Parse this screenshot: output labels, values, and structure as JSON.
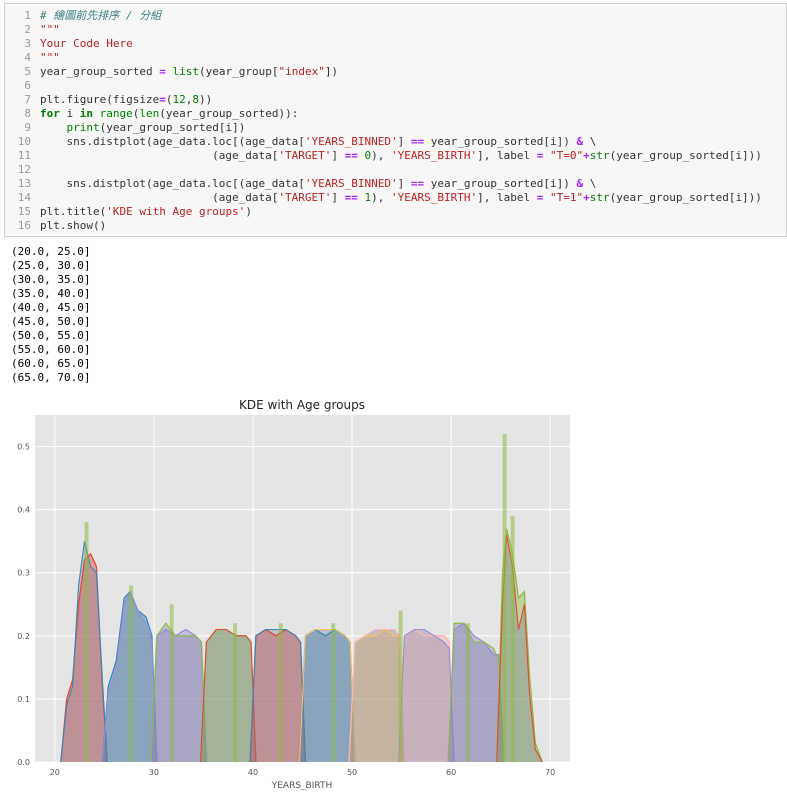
{
  "code_cell": {
    "lines": [
      {
        "n": "1",
        "parts": [
          {
            "t": "# 繪圖前先排序 / 分組",
            "c": "cm"
          }
        ]
      },
      {
        "n": "2",
        "parts": [
          {
            "t": "\"\"\"",
            "c": "str"
          }
        ]
      },
      {
        "n": "3",
        "parts": [
          {
            "t": "Your Code Here",
            "c": "str"
          }
        ]
      },
      {
        "n": "4",
        "parts": [
          {
            "t": "\"\"\"",
            "c": "str"
          }
        ]
      },
      {
        "n": "5",
        "parts": [
          {
            "t": "year_group_sorted ",
            "c": ""
          },
          {
            "t": "=",
            "c": "op"
          },
          {
            "t": " ",
            "c": ""
          },
          {
            "t": "list",
            "c": "bi"
          },
          {
            "t": "(year_group[",
            "c": ""
          },
          {
            "t": "\"index\"",
            "c": "str"
          },
          {
            "t": "])",
            "c": ""
          }
        ]
      },
      {
        "n": "6",
        "parts": []
      },
      {
        "n": "7",
        "parts": [
          {
            "t": "plt.figure(figsize",
            "c": ""
          },
          {
            "t": "=",
            "c": "op"
          },
          {
            "t": "(",
            "c": ""
          },
          {
            "t": "12",
            "c": "num"
          },
          {
            "t": ",",
            "c": ""
          },
          {
            "t": "8",
            "c": "num"
          },
          {
            "t": "))",
            "c": ""
          }
        ]
      },
      {
        "n": "8",
        "parts": [
          {
            "t": "for",
            "c": "kw"
          },
          {
            "t": " i ",
            "c": ""
          },
          {
            "t": "in",
            "c": "kw"
          },
          {
            "t": " ",
            "c": ""
          },
          {
            "t": "range",
            "c": "bi"
          },
          {
            "t": "(",
            "c": ""
          },
          {
            "t": "len",
            "c": "bi"
          },
          {
            "t": "(year_group_sorted)):",
            "c": ""
          }
        ]
      },
      {
        "n": "9",
        "parts": [
          {
            "t": "    ",
            "c": ""
          },
          {
            "t": "print",
            "c": "bi"
          },
          {
            "t": "(year_group_sorted[i])",
            "c": ""
          }
        ]
      },
      {
        "n": "10",
        "parts": [
          {
            "t": "    sns.distplot(age_data.loc[(age_data[",
            "c": ""
          },
          {
            "t": "'YEARS_BINNED'",
            "c": "str"
          },
          {
            "t": "] ",
            "c": ""
          },
          {
            "t": "==",
            "c": "op"
          },
          {
            "t": " year_group_sorted[i]) ",
            "c": ""
          },
          {
            "t": "&",
            "c": "op"
          },
          {
            "t": " \\",
            "c": ""
          }
        ]
      },
      {
        "n": "11",
        "parts": [
          {
            "t": "                          (age_data[",
            "c": ""
          },
          {
            "t": "'TARGET'",
            "c": "str"
          },
          {
            "t": "] ",
            "c": ""
          },
          {
            "t": "==",
            "c": "op"
          },
          {
            "t": " ",
            "c": ""
          },
          {
            "t": "0",
            "c": "num"
          },
          {
            "t": "), ",
            "c": ""
          },
          {
            "t": "'YEARS_BIRTH'",
            "c": "str"
          },
          {
            "t": "], label ",
            "c": ""
          },
          {
            "t": "=",
            "c": "op"
          },
          {
            "t": " ",
            "c": ""
          },
          {
            "t": "\"T=0\"",
            "c": "str"
          },
          {
            "t": "+",
            "c": "op"
          },
          {
            "t": "str",
            "c": "bi"
          },
          {
            "t": "(year_group_sorted[i]))",
            "c": ""
          }
        ]
      },
      {
        "n": "12",
        "parts": []
      },
      {
        "n": "13",
        "parts": [
          {
            "t": "    sns.distplot(age_data.loc[(age_data[",
            "c": ""
          },
          {
            "t": "'YEARS_BINNED'",
            "c": "str"
          },
          {
            "t": "] ",
            "c": ""
          },
          {
            "t": "==",
            "c": "op"
          },
          {
            "t": " year_group_sorted[i]) ",
            "c": ""
          },
          {
            "t": "&",
            "c": "op"
          },
          {
            "t": " \\",
            "c": ""
          }
        ]
      },
      {
        "n": "14",
        "parts": [
          {
            "t": "                          (age_data[",
            "c": ""
          },
          {
            "t": "'TARGET'",
            "c": "str"
          },
          {
            "t": "] ",
            "c": ""
          },
          {
            "t": "==",
            "c": "op"
          },
          {
            "t": " ",
            "c": ""
          },
          {
            "t": "1",
            "c": "num"
          },
          {
            "t": "), ",
            "c": ""
          },
          {
            "t": "'YEARS_BIRTH'",
            "c": "str"
          },
          {
            "t": "], label ",
            "c": ""
          },
          {
            "t": "=",
            "c": "op"
          },
          {
            "t": " ",
            "c": ""
          },
          {
            "t": "\"T=1\"",
            "c": "str"
          },
          {
            "t": "+",
            "c": "op"
          },
          {
            "t": "str",
            "c": "bi"
          },
          {
            "t": "(year_group_sorted[i]))",
            "c": ""
          }
        ]
      },
      {
        "n": "15",
        "parts": [
          {
            "t": "plt.title(",
            "c": ""
          },
          {
            "t": "'KDE with Age groups'",
            "c": "str"
          },
          {
            "t": ")",
            "c": ""
          }
        ]
      },
      {
        "n": "16",
        "parts": [
          {
            "t": "plt.show()",
            "c": ""
          }
        ]
      }
    ]
  },
  "output_lines": [
    "(20.0, 25.0]",
    "(25.0, 30.0]",
    "(30.0, 35.0]",
    "(35.0, 40.0]",
    "(40.0, 45.0]",
    "(45.0, 50.0]",
    "(50.0, 55.0]",
    "(55.0, 60.0]",
    "(60.0, 65.0]",
    "(65.0, 70.0]"
  ],
  "colors": {
    "plot_bg": "#e5e5e5",
    "grid": "#ffffff",
    "groups": [
      "#e24a33",
      "#348abd",
      "#988ed5",
      "#8eba42",
      "#e24a33",
      "#348abd",
      "#fbc15e",
      "#ffb5b8",
      "#988ed5",
      "#8eba42"
    ]
  },
  "chart_data": {
    "type": "area",
    "title": "KDE with Age groups",
    "xlabel": "YEARS_BIRTH",
    "ylabel": "",
    "xlim": [
      18,
      72
    ],
    "ylim": [
      0,
      0.55
    ],
    "xticks": [
      20,
      30,
      40,
      50,
      60,
      70
    ],
    "yticks": [
      0.0,
      0.1,
      0.2,
      0.3,
      0.4,
      0.5
    ],
    "ytick_labels": [
      "0.0",
      "0.1",
      "0.2",
      "0.3",
      "0.4",
      "0.5"
    ],
    "grid": true,
    "series": [
      {
        "range": [
          20,
          25
        ],
        "t0": [
          [
            20.6,
            0
          ],
          [
            21.2,
            0.1
          ],
          [
            21.8,
            0.13
          ],
          [
            22.4,
            0.25
          ],
          [
            23.0,
            0.32
          ],
          [
            23.6,
            0.33
          ],
          [
            24.2,
            0.31
          ],
          [
            24.8,
            0.12
          ],
          [
            25.3,
            0
          ]
        ],
        "t1": [
          [
            20.6,
            0
          ],
          [
            21.2,
            0.09
          ],
          [
            21.8,
            0.12
          ],
          [
            22.4,
            0.28
          ],
          [
            23.0,
            0.35
          ],
          [
            23.6,
            0.31
          ],
          [
            24.2,
            0.3
          ],
          [
            24.8,
            0.13
          ],
          [
            25.3,
            0
          ]
        ]
      },
      {
        "range": [
          25,
          30
        ],
        "t0": [
          [
            24.8,
            0
          ],
          [
            25.4,
            0.12
          ],
          [
            26.2,
            0.16
          ],
          [
            27.0,
            0.26
          ],
          [
            27.6,
            0.27
          ],
          [
            28.4,
            0.24
          ],
          [
            29.2,
            0.23
          ],
          [
            29.8,
            0.2
          ],
          [
            30.3,
            0
          ]
        ],
        "t1": [
          [
            24.8,
            0
          ],
          [
            25.4,
            0.11
          ],
          [
            26.2,
            0.15
          ],
          [
            27.0,
            0.25
          ],
          [
            27.6,
            0.27
          ],
          [
            28.4,
            0.24
          ],
          [
            29.2,
            0.22
          ],
          [
            29.8,
            0.19
          ],
          [
            30.3,
            0
          ]
        ]
      },
      {
        "range": [
          30,
          35
        ],
        "t0": [
          [
            29.7,
            0
          ],
          [
            30.3,
            0.2
          ],
          [
            31.2,
            0.21
          ],
          [
            32.2,
            0.2
          ],
          [
            33.2,
            0.21
          ],
          [
            34.2,
            0.2
          ],
          [
            34.8,
            0.19
          ],
          [
            35.3,
            0
          ]
        ],
        "t1": [
          [
            29.7,
            0
          ],
          [
            30.3,
            0.2
          ],
          [
            31.2,
            0.22
          ],
          [
            32.2,
            0.2
          ],
          [
            33.2,
            0.2
          ],
          [
            34.2,
            0.2
          ],
          [
            34.8,
            0.19
          ],
          [
            35.3,
            0
          ]
        ]
      },
      {
        "range": [
          35,
          40
        ],
        "t0": [
          [
            34.7,
            0
          ],
          [
            35.3,
            0.19
          ],
          [
            36.3,
            0.21
          ],
          [
            37.3,
            0.21
          ],
          [
            38.3,
            0.2
          ],
          [
            39.3,
            0.2
          ],
          [
            39.8,
            0.19
          ],
          [
            40.3,
            0
          ]
        ],
        "t1": [
          [
            34.7,
            0
          ],
          [
            35.3,
            0.19
          ],
          [
            36.3,
            0.21
          ],
          [
            37.3,
            0.21
          ],
          [
            38.3,
            0.2
          ],
          [
            39.3,
            0.2
          ],
          [
            39.8,
            0.19
          ],
          [
            40.3,
            0
          ]
        ]
      },
      {
        "range": [
          40,
          45
        ],
        "t0": [
          [
            39.7,
            0
          ],
          [
            40.3,
            0.2
          ],
          [
            41.3,
            0.21
          ],
          [
            42.3,
            0.2
          ],
          [
            43.3,
            0.21
          ],
          [
            44.3,
            0.2
          ],
          [
            44.8,
            0.19
          ],
          [
            45.3,
            0
          ]
        ],
        "t1": [
          [
            39.7,
            0
          ],
          [
            40.3,
            0.2
          ],
          [
            41.3,
            0.21
          ],
          [
            42.3,
            0.21
          ],
          [
            43.3,
            0.21
          ],
          [
            44.3,
            0.2
          ],
          [
            44.8,
            0.19
          ],
          [
            45.3,
            0
          ]
        ]
      },
      {
        "range": [
          45,
          50
        ],
        "t0": [
          [
            44.7,
            0
          ],
          [
            45.3,
            0.2
          ],
          [
            46.3,
            0.21
          ],
          [
            47.3,
            0.2
          ],
          [
            48.3,
            0.21
          ],
          [
            49.3,
            0.2
          ],
          [
            49.8,
            0.19
          ],
          [
            50.3,
            0
          ]
        ],
        "t1": [
          [
            44.7,
            0
          ],
          [
            45.3,
            0.2
          ],
          [
            46.3,
            0.21
          ],
          [
            47.3,
            0.21
          ],
          [
            48.3,
            0.21
          ],
          [
            49.3,
            0.2
          ],
          [
            49.8,
            0.19
          ],
          [
            50.3,
            0
          ]
        ]
      },
      {
        "range": [
          50,
          55
        ],
        "t0": [
          [
            49.7,
            0
          ],
          [
            50.3,
            0.19
          ],
          [
            51.3,
            0.2
          ],
          [
            52.3,
            0.2
          ],
          [
            53.3,
            0.21
          ],
          [
            54.3,
            0.2
          ],
          [
            54.8,
            0.2
          ],
          [
            55.3,
            0
          ]
        ],
        "t1": [
          [
            49.7,
            0
          ],
          [
            50.3,
            0.19
          ],
          [
            51.3,
            0.2
          ],
          [
            52.3,
            0.21
          ],
          [
            53.3,
            0.21
          ],
          [
            54.3,
            0.21
          ],
          [
            54.8,
            0.2
          ],
          [
            55.3,
            0
          ]
        ]
      },
      {
        "range": [
          55,
          60
        ],
        "t0": [
          [
            54.7,
            0
          ],
          [
            55.3,
            0.2
          ],
          [
            56.3,
            0.21
          ],
          [
            57.3,
            0.2
          ],
          [
            58.3,
            0.2
          ],
          [
            59.3,
            0.2
          ],
          [
            59.8,
            0.19
          ],
          [
            60.3,
            0
          ]
        ],
        "t1": [
          [
            54.7,
            0
          ],
          [
            55.3,
            0.2
          ],
          [
            56.3,
            0.21
          ],
          [
            57.3,
            0.21
          ],
          [
            58.3,
            0.2
          ],
          [
            59.3,
            0.19
          ],
          [
            59.8,
            0.18
          ],
          [
            60.3,
            0
          ]
        ]
      },
      {
        "range": [
          60,
          65
        ],
        "t0": [
          [
            59.7,
            0
          ],
          [
            60.3,
            0.21
          ],
          [
            61.3,
            0.22
          ],
          [
            62.3,
            0.2
          ],
          [
            63.3,
            0.19
          ],
          [
            64.3,
            0.17
          ],
          [
            64.8,
            0.17
          ],
          [
            65.3,
            0
          ]
        ],
        "t1": [
          [
            59.7,
            0
          ],
          [
            60.3,
            0.22
          ],
          [
            61.3,
            0.22
          ],
          [
            62.3,
            0.19
          ],
          [
            63.3,
            0.19
          ],
          [
            64.3,
            0.18
          ],
          [
            64.8,
            0.16
          ],
          [
            65.3,
            0
          ]
        ]
      },
      {
        "range": [
          65,
          70
        ],
        "t0": [
          [
            64.6,
            0
          ],
          [
            65.2,
            0.3
          ],
          [
            65.6,
            0.37
          ],
          [
            66.2,
            0.33
          ],
          [
            66.8,
            0.26
          ],
          [
            67.4,
            0.27
          ],
          [
            67.9,
            0.14
          ],
          [
            68.5,
            0.03
          ],
          [
            69.2,
            0
          ]
        ],
        "t1": [
          [
            64.6,
            0
          ],
          [
            65.2,
            0.25
          ],
          [
            65.6,
            0.36
          ],
          [
            66.2,
            0.31
          ],
          [
            66.8,
            0.21
          ],
          [
            67.4,
            0.25
          ],
          [
            67.9,
            0.11
          ],
          [
            68.5,
            0.02
          ],
          [
            69.2,
            0
          ]
        ]
      }
    ],
    "hist_peaks": [
      {
        "x": 23.2,
        "y": 0.38
      },
      {
        "x": 27.7,
        "y": 0.28
      },
      {
        "x": 31.8,
        "y": 0.25
      },
      {
        "x": 38.2,
        "y": 0.22
      },
      {
        "x": 42.8,
        "y": 0.22
      },
      {
        "x": 48.1,
        "y": 0.22
      },
      {
        "x": 54.9,
        "y": 0.24
      },
      {
        "x": 61.7,
        "y": 0.22
      },
      {
        "x": 65.4,
        "y": 0.52
      },
      {
        "x": 66.2,
        "y": 0.39
      }
    ]
  }
}
